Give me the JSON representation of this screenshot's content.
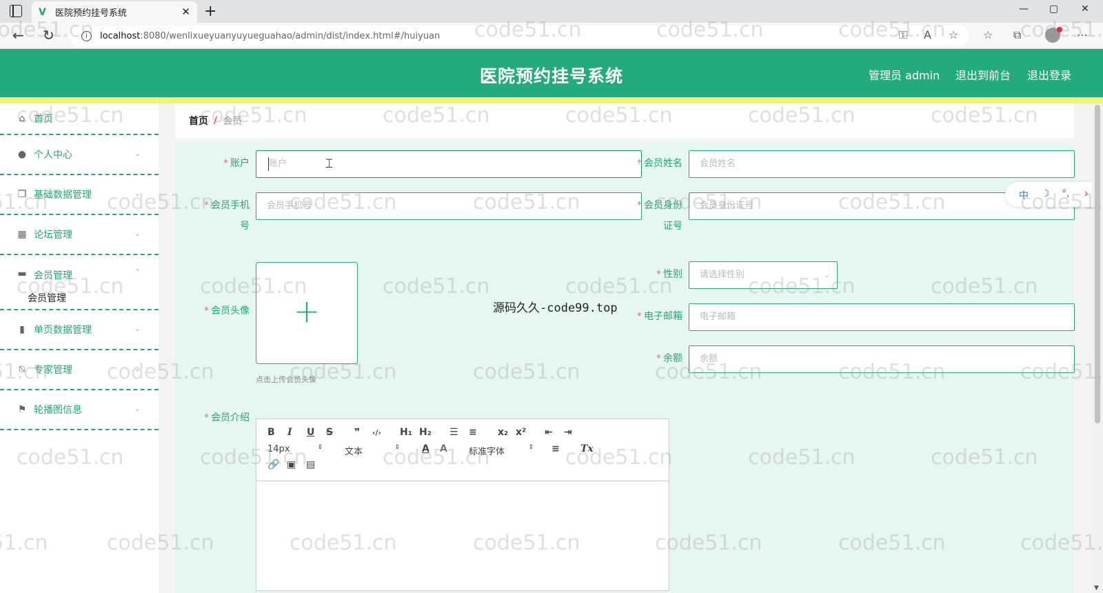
{
  "browser": {
    "tab_title": "医院预约挂号系统",
    "tab_close": "✕",
    "new_tab": "+",
    "url_host": "localhost",
    "url_path": ":8080/wenlixueyuanyuyueguahao/admin/dist/index.html#/huiyuan",
    "window_controls": [
      "—",
      "▢",
      "✕"
    ]
  },
  "header": {
    "title": "医院预约挂号系统",
    "admin_label": "管理员 admin",
    "to_front": "退出到前台",
    "logout": "退出登录"
  },
  "sidebar": {
    "items": [
      {
        "label": "首页",
        "icon": "home-icon"
      },
      {
        "label": "个人中心",
        "icon": "user-icon"
      },
      {
        "label": "基础数据管理",
        "icon": "copy-icon"
      },
      {
        "label": "论坛管理",
        "icon": "grid-icon"
      },
      {
        "label": "会员管理",
        "icon": "briefcase-icon",
        "sub": "会员管理"
      },
      {
        "label": "单页数据管理",
        "icon": "bar-chart-icon"
      },
      {
        "label": "专家管理",
        "icon": "bell-off-icon"
      },
      {
        "label": "轮播图信息",
        "icon": "flag-icon"
      }
    ]
  },
  "breadcrumb": {
    "home": "首页",
    "separator": "/",
    "current": "会员"
  },
  "form": {
    "account": {
      "label": "账户",
      "placeholder": "账户"
    },
    "name": {
      "label": "会员姓名",
      "placeholder": "会员姓名"
    },
    "phone": {
      "label_1": "会员手机",
      "label_2": "号",
      "placeholder": "会员手机号"
    },
    "idcard": {
      "label_1": "会员身份",
      "label_2": "证号",
      "placeholder": "会员身份证号"
    },
    "avatar": {
      "label": "会员头像",
      "hint": "点击上传会员头像",
      "plus": "+"
    },
    "gender": {
      "label": "性别",
      "placeholder": "请选择性别"
    },
    "email": {
      "label": "电子邮箱",
      "placeholder": "电子邮箱"
    },
    "balance": {
      "label": "余额",
      "placeholder": "余额"
    },
    "intro": {
      "label": "会员介绍"
    },
    "required_mark": "*"
  },
  "editor": {
    "row1": [
      "B",
      "I",
      "U",
      "S",
      "❞",
      "‹/›",
      "H₁",
      "H₂",
      "☰",
      "≡",
      "x₂",
      "x²",
      "⇤",
      "⇥"
    ],
    "font_size": "14px",
    "text_style": "文本",
    "color_label": "A",
    "bg_label": "A",
    "font_family": "标准字体",
    "align": "≡",
    "clear": "Tx",
    "row3": [
      "🔗",
      "▣",
      "▤"
    ]
  },
  "overlay_text": "源码久久-code99.top",
  "watermark_text": "code51.cn",
  "ime": {
    "lang": "中",
    "moon": "☽",
    "punct": "°,",
    "arrow": "›"
  },
  "colors": {
    "header": "#23aa7e",
    "accent_strip": "#f4f370",
    "form_bg": "#e6f7f1",
    "label_green": "#25a37b",
    "required_red": "#f56c6c"
  }
}
